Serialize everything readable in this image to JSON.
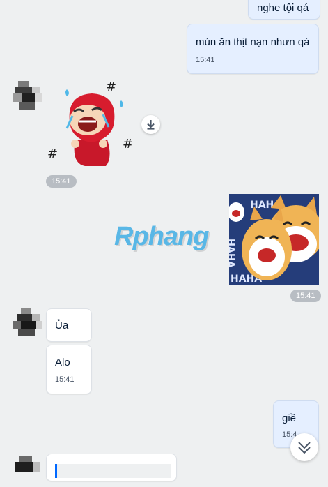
{
  "messages": [
    {
      "text": "nghe tội qá"
    },
    {
      "text": "mún ăn thịt nạn nhưn qá",
      "time": "15:41"
    },
    {
      "sticker": "crying-red-hood-girl-sticker",
      "time": "15:41"
    },
    {
      "sticker": "laughing-shiba-dogs-sticker",
      "sticker_text": "HAHA",
      "time": "15:41"
    },
    {
      "text": "Ủa"
    },
    {
      "text": "Alo",
      "time": "15:41"
    },
    {
      "text": "giề",
      "time": "15:4"
    }
  ],
  "watermark": "Rphang",
  "icons": {
    "download": "download-icon",
    "scroll_down": "chevrons-down-icon"
  },
  "colors": {
    "background": "#eef0f1",
    "outgoing_bubble": "#e5efff",
    "incoming_bubble": "#ffffff",
    "timestamp_pill": "#b8bdc3"
  }
}
